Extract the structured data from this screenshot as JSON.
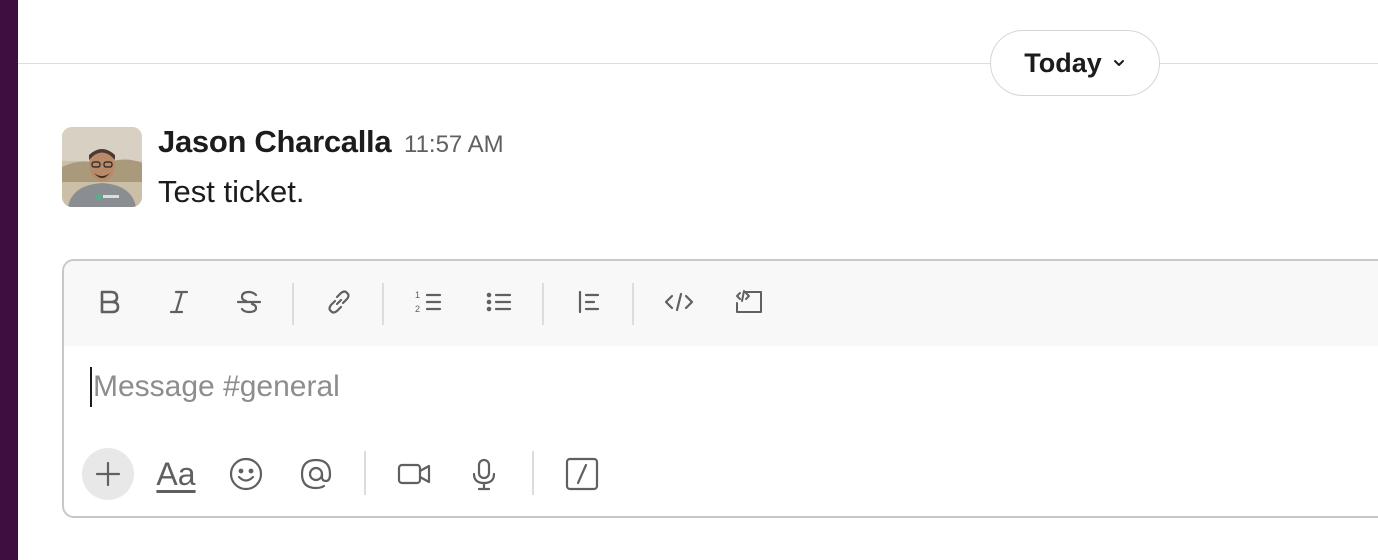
{
  "date_divider": {
    "label": "Today"
  },
  "message": {
    "author": "Jason Charcalla",
    "time": "11:57 AM",
    "text": "Test ticket."
  },
  "composer": {
    "placeholder": "Message #general",
    "format_toolbar": [
      "bold-icon",
      "italic-icon",
      "strikethrough-icon",
      "link-icon",
      "ordered-list-icon",
      "bulleted-list-icon",
      "blockquote-icon",
      "code-icon",
      "code-block-icon"
    ],
    "bottom_toolbar": {
      "formatting_label": "Aa",
      "icons": [
        "plus-icon",
        "emoji-icon",
        "mention-icon",
        "video-icon",
        "microphone-icon",
        "slash-command-icon"
      ]
    }
  },
  "colors": {
    "sidebar": "#3f0e40",
    "text": "#1d1c1d",
    "muted": "#616061"
  }
}
